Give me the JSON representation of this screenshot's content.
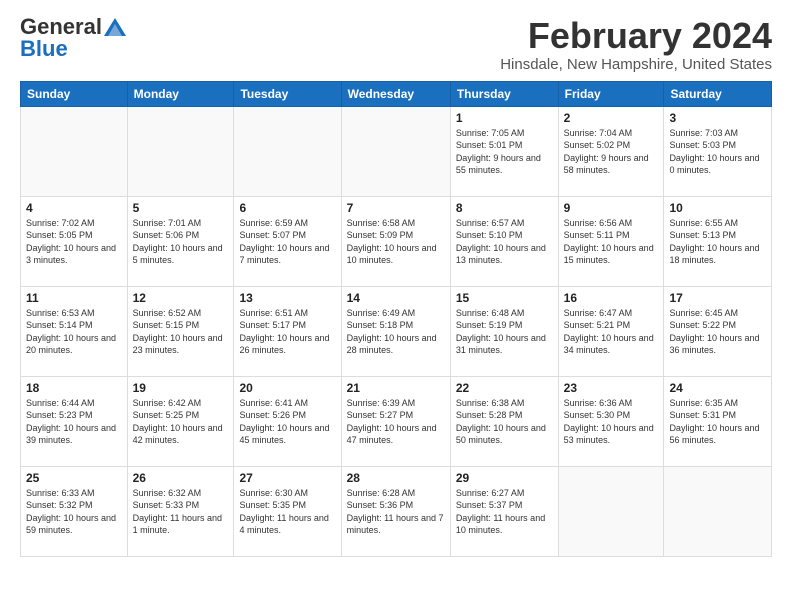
{
  "logo": {
    "general": "General",
    "blue": "Blue"
  },
  "header": {
    "title": "February 2024",
    "subtitle": "Hinsdale, New Hampshire, United States"
  },
  "weekdays": [
    "Sunday",
    "Monday",
    "Tuesday",
    "Wednesday",
    "Thursday",
    "Friday",
    "Saturday"
  ],
  "weeks": [
    [
      {
        "day": "",
        "info": ""
      },
      {
        "day": "",
        "info": ""
      },
      {
        "day": "",
        "info": ""
      },
      {
        "day": "",
        "info": ""
      },
      {
        "day": "1",
        "info": "Sunrise: 7:05 AM\nSunset: 5:01 PM\nDaylight: 9 hours and 55 minutes."
      },
      {
        "day": "2",
        "info": "Sunrise: 7:04 AM\nSunset: 5:02 PM\nDaylight: 9 hours and 58 minutes."
      },
      {
        "day": "3",
        "info": "Sunrise: 7:03 AM\nSunset: 5:03 PM\nDaylight: 10 hours and 0 minutes."
      }
    ],
    [
      {
        "day": "4",
        "info": "Sunrise: 7:02 AM\nSunset: 5:05 PM\nDaylight: 10 hours and 3 minutes."
      },
      {
        "day": "5",
        "info": "Sunrise: 7:01 AM\nSunset: 5:06 PM\nDaylight: 10 hours and 5 minutes."
      },
      {
        "day": "6",
        "info": "Sunrise: 6:59 AM\nSunset: 5:07 PM\nDaylight: 10 hours and 7 minutes."
      },
      {
        "day": "7",
        "info": "Sunrise: 6:58 AM\nSunset: 5:09 PM\nDaylight: 10 hours and 10 minutes."
      },
      {
        "day": "8",
        "info": "Sunrise: 6:57 AM\nSunset: 5:10 PM\nDaylight: 10 hours and 13 minutes."
      },
      {
        "day": "9",
        "info": "Sunrise: 6:56 AM\nSunset: 5:11 PM\nDaylight: 10 hours and 15 minutes."
      },
      {
        "day": "10",
        "info": "Sunrise: 6:55 AM\nSunset: 5:13 PM\nDaylight: 10 hours and 18 minutes."
      }
    ],
    [
      {
        "day": "11",
        "info": "Sunrise: 6:53 AM\nSunset: 5:14 PM\nDaylight: 10 hours and 20 minutes."
      },
      {
        "day": "12",
        "info": "Sunrise: 6:52 AM\nSunset: 5:15 PM\nDaylight: 10 hours and 23 minutes."
      },
      {
        "day": "13",
        "info": "Sunrise: 6:51 AM\nSunset: 5:17 PM\nDaylight: 10 hours and 26 minutes."
      },
      {
        "day": "14",
        "info": "Sunrise: 6:49 AM\nSunset: 5:18 PM\nDaylight: 10 hours and 28 minutes."
      },
      {
        "day": "15",
        "info": "Sunrise: 6:48 AM\nSunset: 5:19 PM\nDaylight: 10 hours and 31 minutes."
      },
      {
        "day": "16",
        "info": "Sunrise: 6:47 AM\nSunset: 5:21 PM\nDaylight: 10 hours and 34 minutes."
      },
      {
        "day": "17",
        "info": "Sunrise: 6:45 AM\nSunset: 5:22 PM\nDaylight: 10 hours and 36 minutes."
      }
    ],
    [
      {
        "day": "18",
        "info": "Sunrise: 6:44 AM\nSunset: 5:23 PM\nDaylight: 10 hours and 39 minutes."
      },
      {
        "day": "19",
        "info": "Sunrise: 6:42 AM\nSunset: 5:25 PM\nDaylight: 10 hours and 42 minutes."
      },
      {
        "day": "20",
        "info": "Sunrise: 6:41 AM\nSunset: 5:26 PM\nDaylight: 10 hours and 45 minutes."
      },
      {
        "day": "21",
        "info": "Sunrise: 6:39 AM\nSunset: 5:27 PM\nDaylight: 10 hours and 47 minutes."
      },
      {
        "day": "22",
        "info": "Sunrise: 6:38 AM\nSunset: 5:28 PM\nDaylight: 10 hours and 50 minutes."
      },
      {
        "day": "23",
        "info": "Sunrise: 6:36 AM\nSunset: 5:30 PM\nDaylight: 10 hours and 53 minutes."
      },
      {
        "day": "24",
        "info": "Sunrise: 6:35 AM\nSunset: 5:31 PM\nDaylight: 10 hours and 56 minutes."
      }
    ],
    [
      {
        "day": "25",
        "info": "Sunrise: 6:33 AM\nSunset: 5:32 PM\nDaylight: 10 hours and 59 minutes."
      },
      {
        "day": "26",
        "info": "Sunrise: 6:32 AM\nSunset: 5:33 PM\nDaylight: 11 hours and 1 minute."
      },
      {
        "day": "27",
        "info": "Sunrise: 6:30 AM\nSunset: 5:35 PM\nDaylight: 11 hours and 4 minutes."
      },
      {
        "day": "28",
        "info": "Sunrise: 6:28 AM\nSunset: 5:36 PM\nDaylight: 11 hours and 7 minutes."
      },
      {
        "day": "29",
        "info": "Sunrise: 6:27 AM\nSunset: 5:37 PM\nDaylight: 11 hours and 10 minutes."
      },
      {
        "day": "",
        "info": ""
      },
      {
        "day": "",
        "info": ""
      }
    ]
  ]
}
